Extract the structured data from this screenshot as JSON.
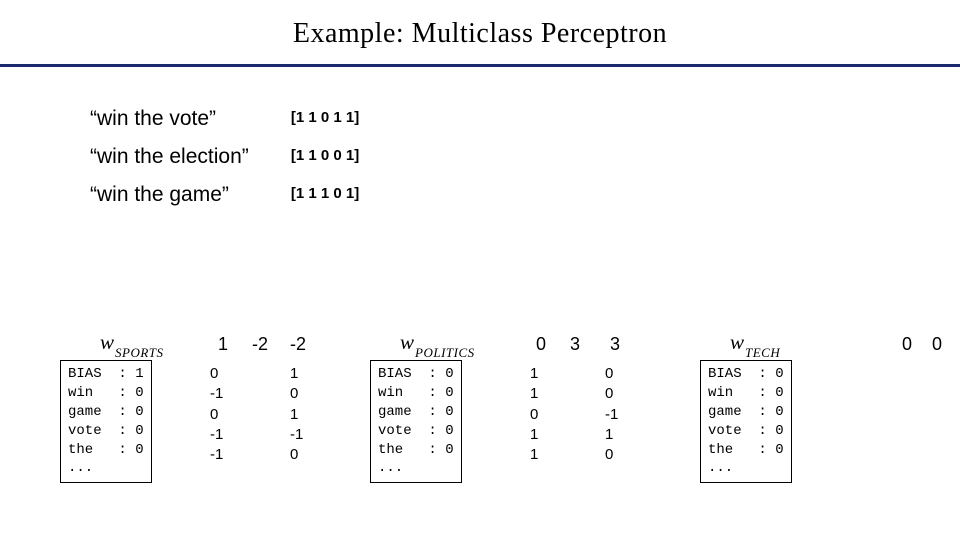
{
  "title": "Example: Multiclass Perceptron",
  "examples": [
    {
      "phrase": "“win the vote”",
      "vector": "[1 1 0 1 1]"
    },
    {
      "phrase": "“win the election”",
      "vector": "[1 1 0 0 1]"
    },
    {
      "phrase": "“win the game”",
      "vector": "[1 1 1 0 1]"
    }
  ],
  "labels": {
    "sports": {
      "w": "w",
      "sub": "SPORTS"
    },
    "politics": {
      "w": "w",
      "sub": "POLITICS"
    },
    "tech": {
      "w": "w",
      "sub": "TECH"
    }
  },
  "scores": {
    "sports": [
      "1",
      "-2",
      "-2"
    ],
    "politics": [
      "0",
      "3",
      "3"
    ],
    "tech": [
      "0",
      "0"
    ]
  },
  "tables": {
    "sports": "BIAS  : 1\nwin   : 0\ngame  : 0\nvote  : 0\nthe   : 0\n...",
    "politics": "BIAS  : 0\nwin   : 0\ngame  : 0\nvote  : 0\nthe   : 0\n...",
    "tech": "BIAS  : 0\nwin   : 0\ngame  : 0\nvote  : 0\nthe   : 0\n..."
  },
  "cols": {
    "sports_a": "0\n-1\n0\n-1\n-1",
    "sports_b": "1\n0\n1\n-1\n0",
    "politics_a": "1\n1\n0\n1\n1",
    "politics_b": "0\n0\n-1\n1\n0"
  }
}
